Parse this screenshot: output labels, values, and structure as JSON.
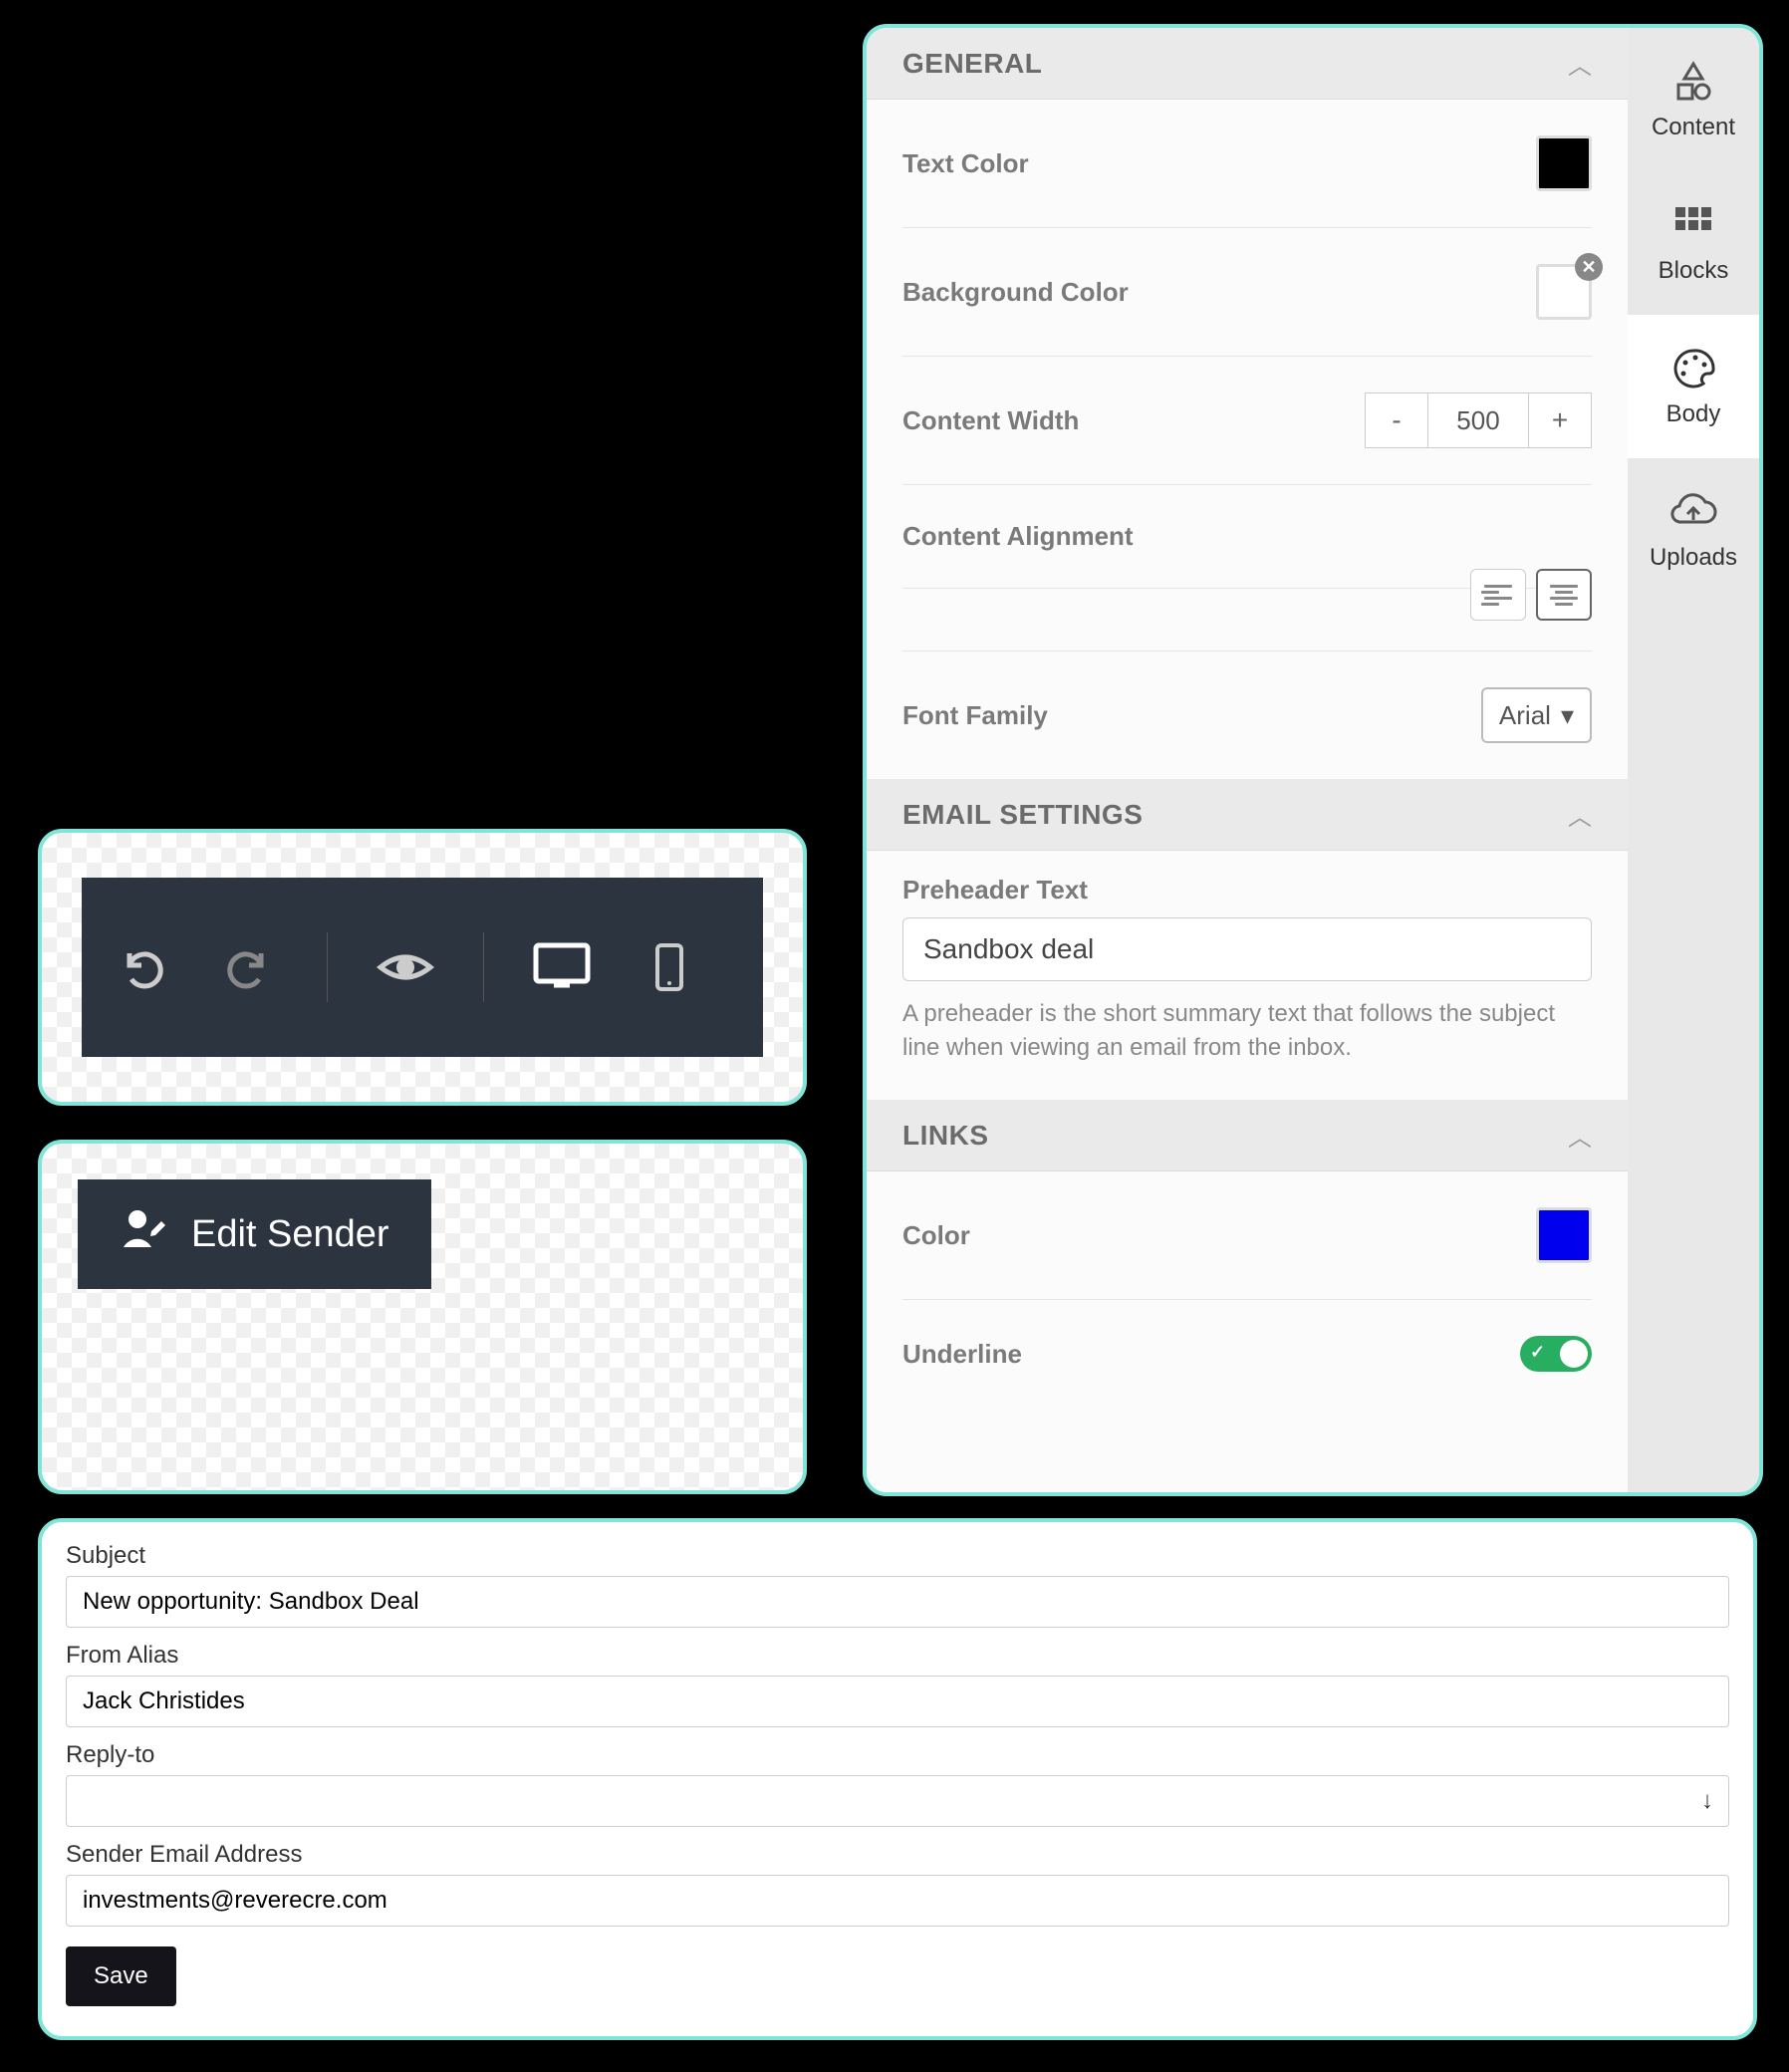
{
  "tabs": {
    "content": "Content",
    "blocks": "Blocks",
    "body": "Body",
    "uploads": "Uploads"
  },
  "general": {
    "title": "GENERAL",
    "text_color_label": "Text Color",
    "text_color": "#000000",
    "bg_color_label": "Background Color",
    "bg_color": "#ffffff",
    "content_width_label": "Content Width",
    "content_width": "500",
    "content_align_label": "Content Alignment",
    "font_family_label": "Font Family",
    "font_family": "Arial"
  },
  "email_settings": {
    "title": "EMAIL SETTINGS",
    "preheader_label": "Preheader Text",
    "preheader_value": "Sandbox deal",
    "preheader_help": "A preheader is the short summary text that follows the subject line when viewing an email from the inbox."
  },
  "links": {
    "title": "LINKS",
    "color_label": "Color",
    "color": "#0000ee",
    "underline_label": "Underline",
    "underline": true
  },
  "edit_sender": {
    "label": "Edit Sender"
  },
  "form": {
    "subject_label": "Subject",
    "subject_value": "New opportunity: Sandbox Deal",
    "from_alias_label": "From Alias",
    "from_alias_value": "Jack Christides",
    "reply_to_label": "Reply-to",
    "reply_to_value": "",
    "sender_email_label": "Sender Email Address",
    "sender_email_value": "investments@reverecre.com",
    "save_label": "Save"
  }
}
